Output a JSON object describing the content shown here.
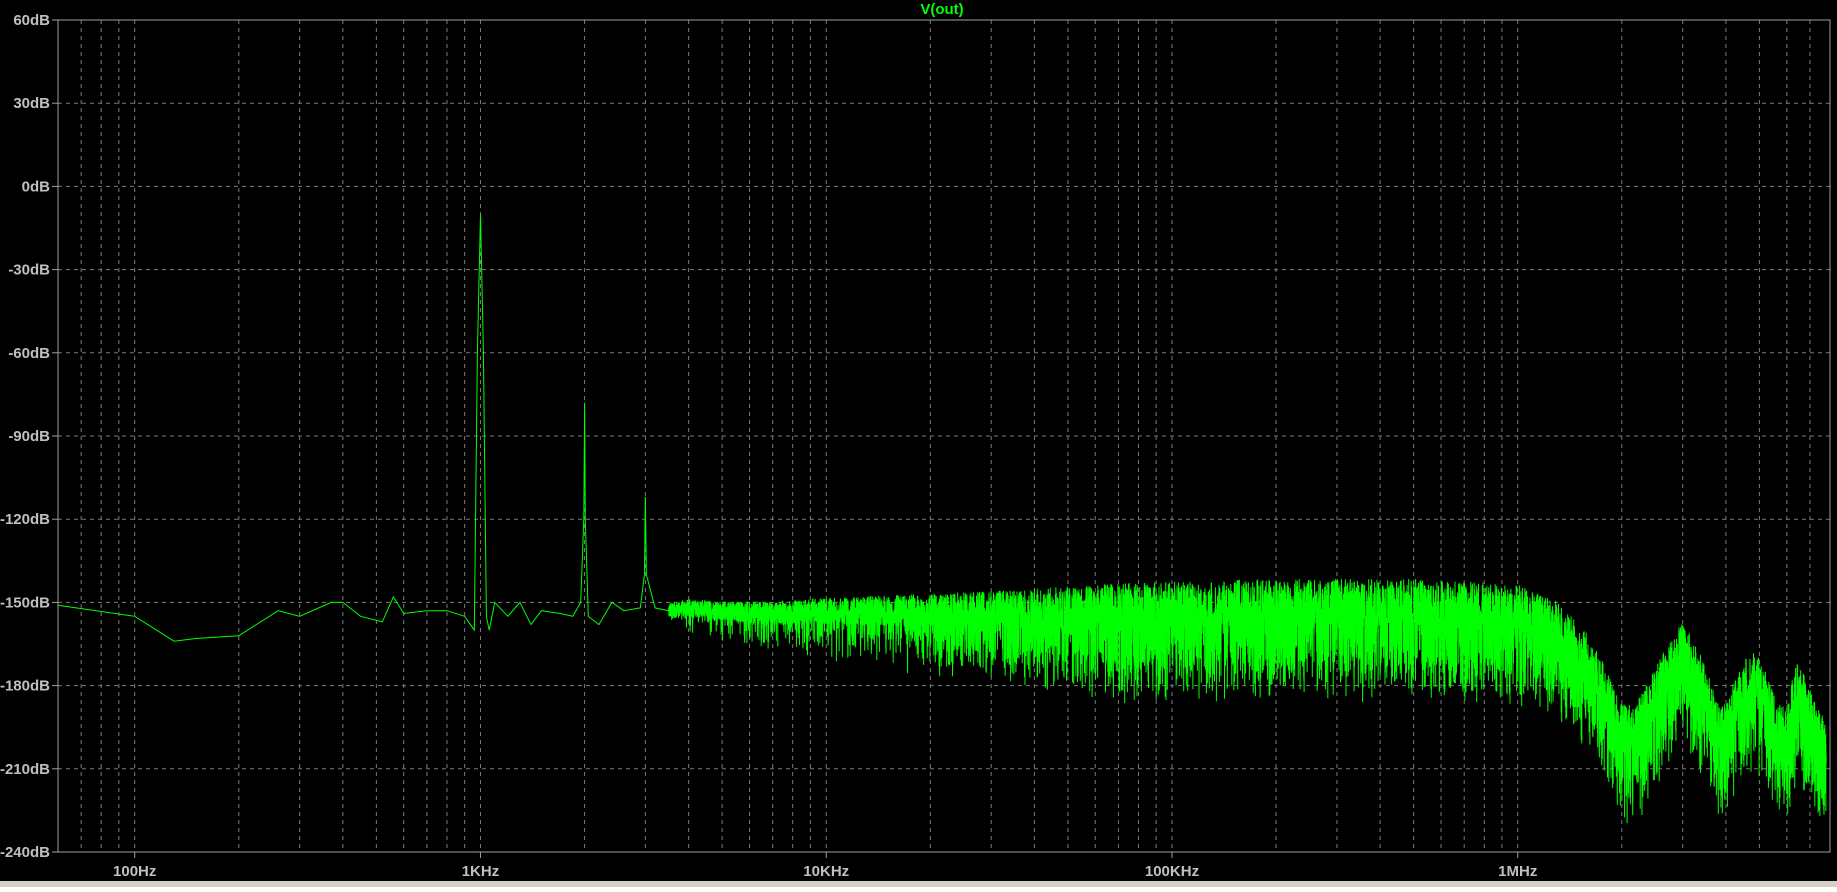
{
  "chart_data": {
    "type": "line",
    "title": "V(out)",
    "x_scale": "log",
    "xlim": [
      60,
      8000000
    ],
    "ylim": [
      -240,
      60
    ],
    "y_unit": "dB",
    "grid": true,
    "y_ticks": [
      60,
      30,
      0,
      -30,
      -60,
      -90,
      -120,
      -150,
      -180,
      -210,
      -240
    ],
    "y_tick_labels": [
      "60dB",
      "30dB",
      "0dB",
      "-30dB",
      "-60dB",
      "-90dB",
      "-120dB",
      "-150dB",
      "-180dB",
      "-210dB",
      "-240dB"
    ],
    "x_ticks": [
      100,
      1000,
      10000,
      100000,
      1000000
    ],
    "x_tick_labels": [
      "100Hz",
      "1KHz",
      "10KHz",
      "100KHz",
      "1MHz"
    ],
    "series": [
      {
        "name": "V(out)",
        "color": "#00ff00",
        "x": [
          60,
          100,
          130,
          150,
          200,
          260,
          300,
          370,
          400,
          450,
          520,
          560,
          600,
          700,
          800,
          900,
          960,
          980,
          1000,
          1020,
          1040,
          1060,
          1100,
          1200,
          1300,
          1400,
          1500,
          1700,
          1850,
          1950,
          1990,
          2000,
          2010,
          2050,
          2200,
          2400,
          2600,
          2900,
          2980,
          3000,
          3020,
          3200,
          3500,
          4000,
          5000,
          7000,
          10000,
          20000,
          50000,
          100000,
          200000,
          500000,
          1000000,
          1300000,
          1600000,
          1800000,
          2000000,
          2200000,
          2600000,
          3000000,
          3400000,
          3800000,
          4000000,
          4300000,
          4800000,
          5200000,
          5600000,
          6000000,
          6400000,
          6800000,
          7300000,
          7800000
        ],
        "y": [
          -151,
          -155,
          -164,
          -163,
          -162,
          -153,
          -155,
          -150,
          -150,
          -155,
          -157,
          -148,
          -154,
          -153,
          -153,
          -155,
          -160,
          -60,
          -10,
          -60,
          -155,
          -160,
          -150,
          -155,
          -150,
          -158,
          -153,
          -154,
          -155,
          -150,
          -120,
          -78,
          -120,
          -155,
          -158,
          -150,
          -153,
          -152,
          -140,
          -112,
          -140,
          -152,
          -153,
          -152,
          -153,
          -154,
          -153,
          -153,
          -152,
          -151,
          -150,
          -150,
          -152,
          -158,
          -170,
          -182,
          -195,
          -195,
          -178,
          -165,
          -178,
          -195,
          -195,
          -182,
          -175,
          -182,
          -195,
          -195,
          -180,
          -185,
          -195,
          -200
        ]
      }
    ]
  }
}
